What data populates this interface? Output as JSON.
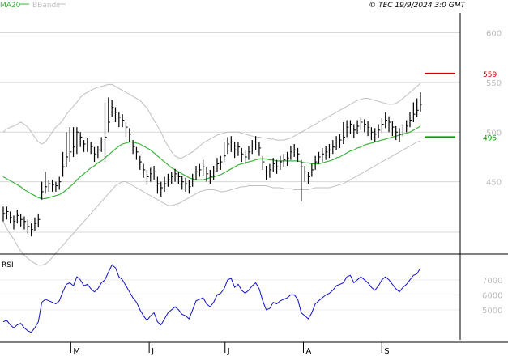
{
  "header": {
    "legend": [
      {
        "label": "MA20",
        "color": "#3cb43c"
      },
      {
        "label": "BBands",
        "color": "#bfbfbf"
      }
    ],
    "copyright": "© TEC 19/9/2024 3:0 GMT"
  },
  "colors": {
    "price_bars": "#000000",
    "ma20": "#3cb43c",
    "bbands": "#bfbfbf",
    "rsi": "#1010c8",
    "resistance": "#cc0000",
    "support": "#00a000",
    "grid": "#d8d8d8"
  },
  "chart_data": [
    {
      "type": "ohlc",
      "ylim": [
        400,
        620
      ],
      "y_ticks": [
        450,
        500,
        550,
        600
      ],
      "x_tick_labels": [
        "M",
        "J",
        "J",
        "A",
        "S"
      ],
      "x_tick_dates": [
        "2024-05-01",
        "2024-06-01",
        "2024-07-01",
        "2024-08-01",
        "2024-09-01"
      ],
      "x_range": [
        "2024-04-03",
        "2024-10-02"
      ],
      "grid": true,
      "levels": [
        {
          "name": "resistance",
          "value": 559,
          "label": "559",
          "color": "#cc0000"
        },
        {
          "name": "support",
          "value": 495,
          "label": "495",
          "color": "#00a000"
        }
      ],
      "series": [
        {
          "name": "price",
          "dates": [
            "2024-04-03",
            "2024-04-04",
            "2024-04-05",
            "2024-04-08",
            "2024-04-09",
            "2024-04-10",
            "2024-04-11",
            "2024-04-12",
            "2024-04-15",
            "2024-04-16",
            "2024-04-17",
            "2024-04-18",
            "2024-04-19",
            "2024-04-22",
            "2024-04-23",
            "2024-04-24",
            "2024-04-25",
            "2024-04-26",
            "2024-04-29",
            "2024-04-30",
            "2024-05-02",
            "2024-05-03",
            "2024-05-06",
            "2024-05-07",
            "2024-05-08",
            "2024-05-09",
            "2024-05-10",
            "2024-05-13",
            "2024-05-14",
            "2024-05-15",
            "2024-05-16",
            "2024-05-17",
            "2024-05-20",
            "2024-05-21",
            "2024-05-22",
            "2024-05-23",
            "2024-05-24",
            "2024-05-27",
            "2024-05-28",
            "2024-05-29",
            "2024-05-30",
            "2024-05-31",
            "2024-06-03",
            "2024-06-04",
            "2024-06-05",
            "2024-06-06",
            "2024-06-07",
            "2024-06-10",
            "2024-06-11",
            "2024-06-12",
            "2024-06-13",
            "2024-06-14",
            "2024-06-17",
            "2024-06-18",
            "2024-06-19",
            "2024-06-20",
            "2024-06-21",
            "2024-06-24",
            "2024-06-25",
            "2024-06-26",
            "2024-06-27",
            "2024-06-28",
            "2024-07-01",
            "2024-07-02",
            "2024-07-03",
            "2024-07-04",
            "2024-07-05",
            "2024-07-08",
            "2024-07-09",
            "2024-07-10",
            "2024-07-11",
            "2024-07-12",
            "2024-07-15",
            "2024-07-16",
            "2024-07-17",
            "2024-07-18",
            "2024-07-19",
            "2024-07-22",
            "2024-07-23",
            "2024-07-24",
            "2024-07-25",
            "2024-07-26",
            "2024-07-29",
            "2024-07-30",
            "2024-07-31",
            "2024-08-01",
            "2024-08-02",
            "2024-08-05",
            "2024-08-06",
            "2024-08-07",
            "2024-08-08",
            "2024-08-09",
            "2024-08-12",
            "2024-08-13",
            "2024-08-14",
            "2024-08-15",
            "2024-08-16",
            "2024-08-19",
            "2024-08-20",
            "2024-08-21",
            "2024-08-22",
            "2024-08-23",
            "2024-08-26",
            "2024-08-27",
            "2024-08-28",
            "2024-08-29",
            "2024-08-30",
            "2024-09-02",
            "2024-09-03",
            "2024-09-04",
            "2024-09-05",
            "2024-09-06",
            "2024-09-09",
            "2024-09-10",
            "2024-09-11",
            "2024-09-12",
            "2024-09-13",
            "2024-09-16",
            "2024-09-17",
            "2024-09-18"
          ],
          "close": [
            418,
            420,
            414,
            410,
            416,
            412,
            410,
            405,
            402,
            408,
            412,
            440,
            445,
            448,
            447,
            446,
            450,
            465,
            475,
            480,
            485,
            500,
            495,
            488,
            490,
            485,
            478,
            482,
            490,
            495,
            510,
            525,
            520,
            515,
            512,
            505,
            498,
            485,
            480,
            470,
            462,
            455,
            458,
            460,
            448,
            444,
            448,
            452,
            455,
            458,
            455,
            450,
            448,
            445,
            452,
            460,
            462,
            465,
            458,
            455,
            460,
            468,
            470,
            476,
            488,
            490,
            482,
            485,
            478,
            475,
            480,
            486,
            490,
            484,
            470,
            460,
            462,
            468,
            465,
            470,
            472,
            474,
            480,
            482,
            478,
            465,
            460,
            455,
            462,
            470,
            475,
            478,
            480,
            482,
            485,
            490,
            492,
            495,
            505,
            508,
            502,
            506,
            510,
            508,
            505,
            500,
            498,
            502,
            508,
            512,
            510,
            505,
            500,
            498,
            503,
            506,
            512,
            518,
            522,
            528
          ],
          "high": [
            425,
            425,
            420,
            416,
            422,
            418,
            415,
            412,
            408,
            414,
            418,
            450,
            460,
            452,
            452,
            450,
            455,
            480,
            500,
            505,
            505,
            505,
            500,
            492,
            494,
            490,
            485,
            486,
            495,
            530,
            535,
            532,
            525,
            520,
            518,
            510,
            504,
            492,
            485,
            476,
            468,
            462,
            464,
            466,
            455,
            450,
            455,
            458,
            460,
            463,
            460,
            456,
            454,
            452,
            458,
            466,
            468,
            472,
            465,
            462,
            466,
            474,
            476,
            490,
            495,
            496,
            490,
            490,
            484,
            482,
            486,
            492,
            496,
            490,
            476,
            466,
            468,
            474,
            472,
            476,
            478,
            480,
            486,
            488,
            484,
            472,
            466,
            460,
            468,
            476,
            480,
            484,
            486,
            488,
            492,
            496,
            498,
            510,
            512,
            512,
            508,
            512,
            515,
            513,
            511,
            505,
            504,
            508,
            514,
            520,
            516,
            511,
            506,
            504,
            508,
            512,
            520,
            530,
            534,
            540
          ],
          "low": [
            410,
            412,
            408,
            402,
            408,
            405,
            402,
            398,
            395,
            400,
            404,
            432,
            438,
            440,
            440,
            440,
            442,
            455,
            465,
            470,
            475,
            478,
            485,
            480,
            480,
            478,
            470,
            474,
            480,
            470,
            500,
            515,
            510,
            505,
            505,
            495,
            490,
            478,
            472,
            462,
            454,
            448,
            450,
            452,
            438,
            435,
            440,
            445,
            448,
            450,
            448,
            442,
            440,
            438,
            445,
            452,
            455,
            456,
            450,
            448,
            452,
            460,
            462,
            470,
            478,
            480,
            474,
            476,
            470,
            468,
            472,
            478,
            482,
            476,
            462,
            452,
            454,
            460,
            458,
            462,
            465,
            466,
            472,
            475,
            470,
            430,
            450,
            448,
            455,
            462,
            468,
            470,
            472,
            474,
            478,
            482,
            484,
            488,
            495,
            498,
            494,
            498,
            502,
            500,
            496,
            492,
            490,
            494,
            500,
            504,
            500,
            496,
            492,
            490,
            496,
            500,
            505,
            510,
            515,
            520
          ]
        },
        {
          "name": "MA20",
          "values": [
            455,
            453,
            451,
            449,
            447,
            445,
            442,
            440,
            438,
            436,
            434,
            433,
            433,
            434,
            435,
            436,
            437,
            439,
            442,
            445,
            448,
            452,
            455,
            458,
            461,
            464,
            466,
            469,
            471,
            474,
            477,
            480,
            483,
            486,
            488,
            489,
            490,
            490,
            489,
            488,
            486,
            484,
            482,
            479,
            476,
            473,
            470,
            467,
            464,
            462,
            460,
            458,
            456,
            454,
            453,
            452,
            452,
            452,
            453,
            454,
            455,
            456,
            457,
            459,
            461,
            463,
            465,
            467,
            468,
            469,
            470,
            471,
            472,
            473,
            473,
            473,
            472,
            472,
            471,
            471,
            471,
            471,
            471,
            471,
            471,
            470,
            469,
            469,
            468,
            468,
            468,
            469,
            470,
            471,
            472,
            474,
            475,
            477,
            479,
            481,
            482,
            484,
            485,
            487,
            488,
            489,
            490,
            491,
            492,
            493,
            494,
            495,
            496,
            497,
            498,
            499,
            500,
            502,
            504,
            506
          ]
        },
        {
          "name": "BBands upper",
          "values": [
            500,
            503,
            505,
            506,
            508,
            510,
            508,
            505,
            500,
            495,
            490,
            488,
            490,
            495,
            500,
            505,
            508,
            512,
            518,
            522,
            526,
            530,
            535,
            538,
            540,
            542,
            544,
            545,
            546,
            547,
            548,
            548,
            546,
            544,
            542,
            540,
            538,
            536,
            534,
            532,
            528,
            524,
            518,
            512,
            506,
            500,
            492,
            486,
            480,
            476,
            474,
            474,
            476,
            478,
            480,
            483,
            486,
            489,
            491,
            493,
            495,
            497,
            498,
            499,
            500,
            500,
            500,
            500,
            499,
            498,
            497,
            496,
            495,
            495,
            494,
            494,
            493,
            493,
            492,
            492,
            492,
            493,
            494,
            496,
            498,
            500,
            502,
            504,
            506,
            508,
            510,
            512,
            514,
            516,
            518,
            520,
            522,
            524,
            526,
            528,
            530,
            532,
            533,
            534,
            534,
            533,
            532,
            531,
            530,
            529,
            528,
            528,
            529,
            531,
            534,
            537,
            540,
            543,
            546,
            549
          ]
        },
        {
          "name": "BBands lower",
          "values": [
            410,
            403,
            397,
            392,
            386,
            380,
            376,
            373,
            370,
            368,
            366,
            366,
            367,
            370,
            374,
            378,
            382,
            386,
            390,
            394,
            398,
            402,
            406,
            410,
            414,
            418,
            422,
            426,
            430,
            434,
            438,
            442,
            446,
            448,
            450,
            450,
            448,
            446,
            444,
            442,
            440,
            438,
            436,
            434,
            432,
            430,
            428,
            426,
            426,
            427,
            428,
            430,
            432,
            434,
            436,
            438,
            440,
            441,
            442,
            442,
            442,
            441,
            440,
            440,
            441,
            442,
            443,
            444,
            445,
            445,
            446,
            446,
            446,
            446,
            446,
            446,
            445,
            444,
            444,
            444,
            443,
            443,
            443,
            442,
            442,
            442,
            442,
            442,
            443,
            444,
            444,
            444,
            444,
            444,
            445,
            446,
            447,
            448,
            450,
            452,
            454,
            456,
            458,
            460,
            462,
            464,
            466,
            468,
            470,
            472,
            474,
            476,
            478,
            480,
            482,
            484,
            486,
            488,
            490,
            491
          ]
        }
      ]
    },
    {
      "type": "line",
      "title": "RSI",
      "ylim": [
        30,
        85
      ],
      "y_ticks": [
        50,
        60,
        70
      ],
      "y_tick_labels": [
        "5000",
        "6000",
        "7000"
      ],
      "series": [
        {
          "name": "RSI",
          "values": [
            42,
            43,
            40,
            38,
            40,
            41,
            38,
            36,
            35,
            38,
            42,
            55,
            57,
            56,
            55,
            54,
            56,
            62,
            67,
            68,
            66,
            72,
            70,
            66,
            67,
            64,
            62,
            64,
            68,
            70,
            75,
            80,
            78,
            72,
            70,
            66,
            62,
            58,
            55,
            50,
            46,
            43,
            46,
            48,
            42,
            40,
            44,
            48,
            50,
            52,
            50,
            47,
            46,
            44,
            50,
            56,
            57,
            58,
            54,
            52,
            55,
            60,
            61,
            64,
            70,
            71,
            65,
            67,
            63,
            61,
            63,
            66,
            68,
            64,
            56,
            50,
            51,
            55,
            54,
            56,
            57,
            58,
            60,
            60,
            57,
            48,
            46,
            44,
            48,
            54,
            56,
            58,
            60,
            61,
            63,
            66,
            67,
            68,
            72,
            73,
            68,
            70,
            72,
            70,
            68,
            65,
            63,
            66,
            70,
            72,
            70,
            67,
            64,
            62,
            65,
            67,
            70,
            73,
            74,
            78
          ]
        }
      ]
    }
  ]
}
